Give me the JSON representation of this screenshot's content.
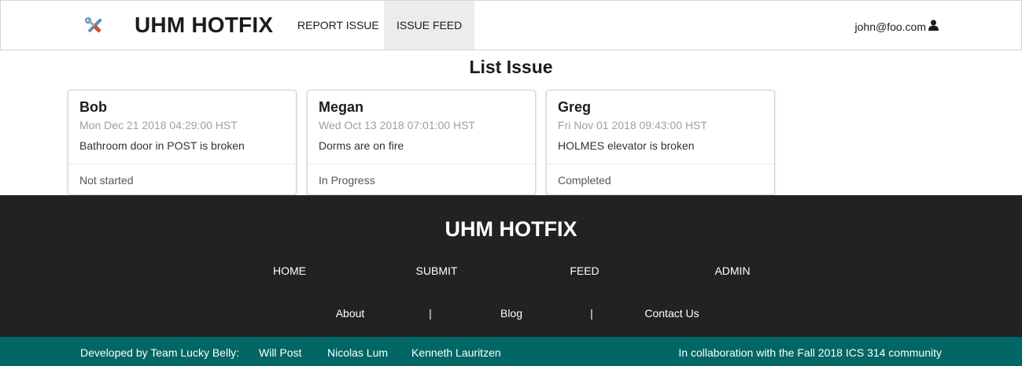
{
  "navbar": {
    "brand": "UHM HOTFIX",
    "items": [
      {
        "label": "REPORT ISSUE"
      },
      {
        "label": "ISSUE FEED"
      }
    ],
    "user": "john@foo.com"
  },
  "page_title": "List Issue",
  "issues": [
    {
      "name": "Bob",
      "date": "Mon Dec 21 2018 04:29:00 HST",
      "description": "Bathroom door in POST is broken",
      "status": "Not started"
    },
    {
      "name": "Megan",
      "date": "Wed Oct 13 2018 07:01:00 HST",
      "description": "Dorms are on fire",
      "status": "In Progress"
    },
    {
      "name": "Greg",
      "date": "Fri Nov 01 2018 09:43:00 HST",
      "description": "HOLMES elevator is broken",
      "status": "Completed"
    }
  ],
  "footer": {
    "brand": "UHM HOTFIX",
    "nav": [
      {
        "label": "HOME"
      },
      {
        "label": "SUBMIT"
      },
      {
        "label": "FEED"
      },
      {
        "label": "ADMIN"
      }
    ],
    "links": [
      {
        "label": "About"
      },
      {
        "label": "Blog"
      },
      {
        "label": "Contact Us"
      }
    ],
    "separator": "|",
    "developed_by": "Developed by Team Lucky Belly:",
    "developers": [
      "Will Post",
      "Nicolas Lum",
      "Kenneth Lauritzen"
    ],
    "collaboration": "In collaboration with the Fall 2018 ICS 314 community"
  },
  "colors": {
    "footer_bg": "#212223",
    "bottom_bar_bg": "#006666",
    "active_nav_bg": "#ececec"
  }
}
